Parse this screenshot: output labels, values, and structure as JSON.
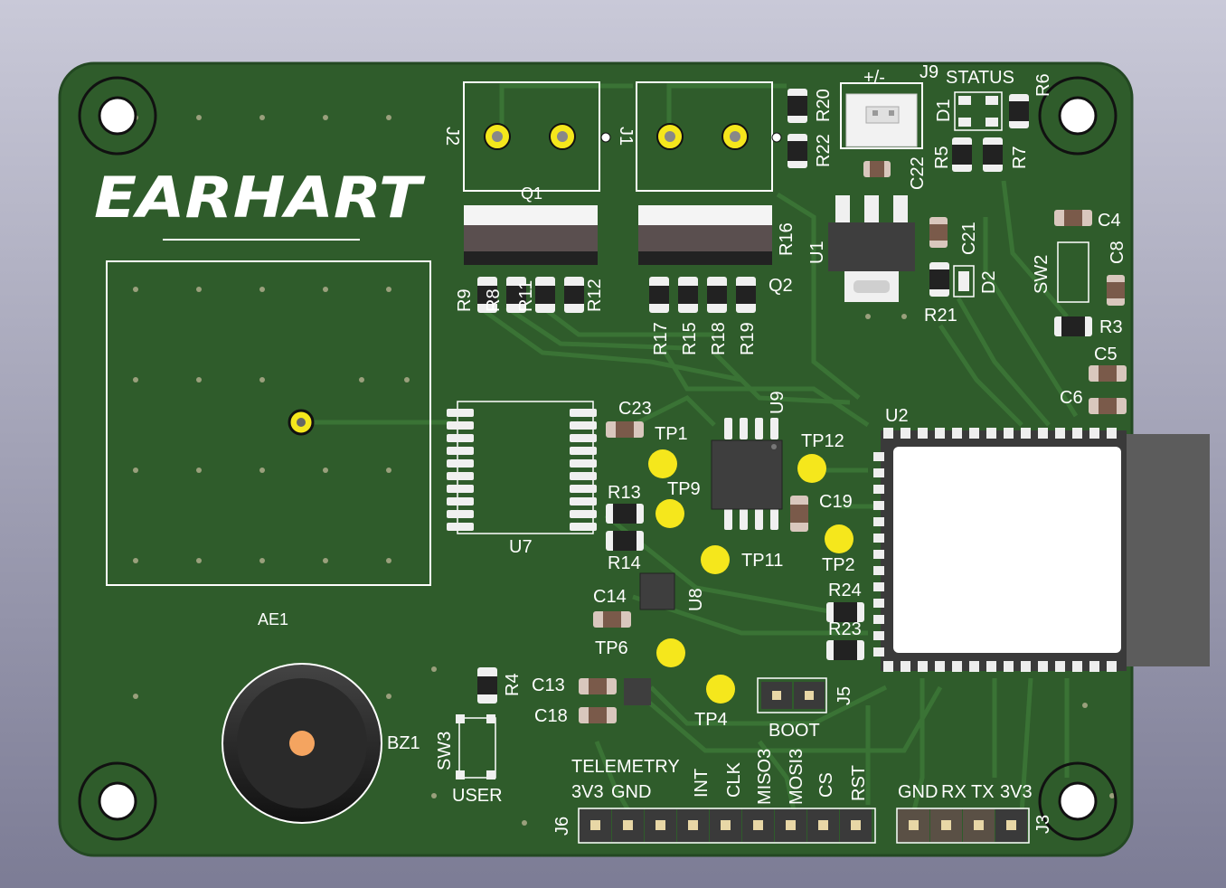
{
  "board": {
    "logo": "EARHART",
    "colors": {
      "pcb": "#2f5c2b",
      "trace": "#386e32",
      "silk": "#ffffff",
      "pad": "#f5e71c",
      "chip": "#3e3e3e"
    }
  },
  "refs": {
    "J1": "J1",
    "J2": "J2",
    "J3": "J3",
    "J5": "J5",
    "J6": "J6",
    "J9": "J9",
    "Q1": "Q1",
    "Q2": "Q2",
    "U1": "U1",
    "U2": "U2",
    "U7": "U7",
    "U8": "U8",
    "U9": "U9",
    "AE1": "AE1",
    "BZ1": "BZ1",
    "SW2": "SW2",
    "SW3": "SW3",
    "D1": "D1",
    "D2": "D2",
    "R3": "R3",
    "R4": "R4",
    "R5": "R5",
    "R6": "R6",
    "R7": "R7",
    "R8": "R8",
    "R9": "R9",
    "R11": "R11",
    "R12": "R12",
    "R13": "R13",
    "R14": "R14",
    "R15": "R15",
    "R16": "R16",
    "R17": "R17",
    "R18": "R18",
    "R19": "R19",
    "R20": "R20",
    "R21": "R21",
    "R22": "R22",
    "R23": "R23",
    "R24": "R24",
    "C4": "C4",
    "C5": "C5",
    "C6": "C6",
    "C8": "C8",
    "C13": "C13",
    "C14": "C14",
    "C18": "C18",
    "C19": "C19",
    "C21": "C21",
    "C22": "C22",
    "C23": "C23",
    "TP1": "TP1",
    "TP2": "TP2",
    "TP4": "TP4",
    "TP6": "TP6",
    "TP9": "TP9",
    "TP11": "TP11",
    "TP12": "TP12"
  },
  "labels": {
    "status": "STATUS",
    "power": "+/-",
    "boot": "BOOT",
    "user": "USER",
    "telemetry": "TELEMETRY"
  },
  "telemetry_pins": [
    "3V3",
    "GND",
    "INT",
    "CLK",
    "MISO3",
    "MOSI3",
    "CS",
    "RST"
  ],
  "uart_pins": [
    "GND",
    "RX",
    "TX",
    "3V3"
  ]
}
